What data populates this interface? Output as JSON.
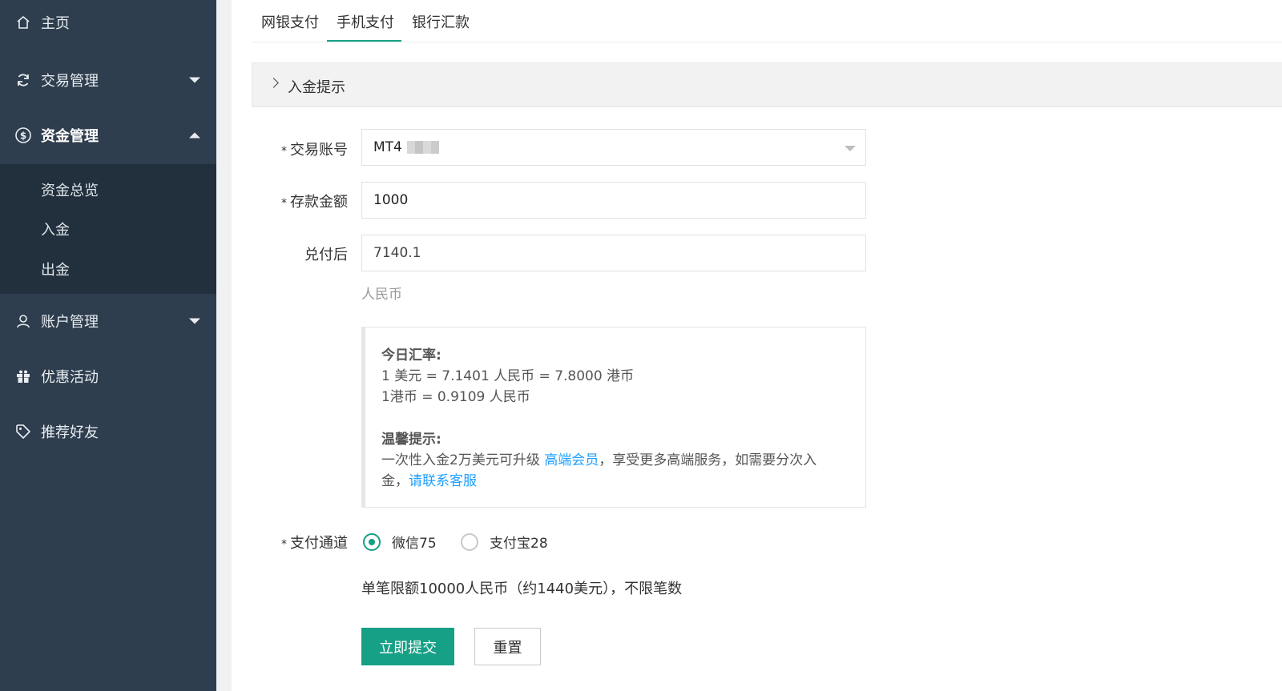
{
  "sidebar": {
    "items": [
      {
        "label": "主页",
        "icon": "home-icon"
      },
      {
        "label": "交易管理",
        "icon": "refresh-icon"
      },
      {
        "label": "资金管理",
        "icon": "dollar-icon"
      },
      {
        "label": "账户管理",
        "icon": "user-icon"
      },
      {
        "label": "优惠活动",
        "icon": "gift-icon"
      },
      {
        "label": "推荐好友",
        "icon": "tag-icon"
      }
    ],
    "submenu": [
      {
        "label": "资金总览"
      },
      {
        "label": "入金"
      },
      {
        "label": "出金"
      }
    ]
  },
  "tabs": [
    {
      "label": "网银支付"
    },
    {
      "label": "手机支付",
      "active": true
    },
    {
      "label": "银行汇款"
    }
  ],
  "collapse": {
    "title": "入金提示"
  },
  "form": {
    "account": {
      "required": "*",
      "label": "交易账号",
      "value": "MT4"
    },
    "amount": {
      "required": "*",
      "label": "存款金额",
      "value": "1000"
    },
    "converted": {
      "label": "兑付后",
      "value": "7140.1",
      "hint": "人民币"
    },
    "channel": {
      "required": "*",
      "label": "支付通道",
      "options": [
        {
          "label": "微信75",
          "selected": true
        },
        {
          "label": "支付宝28",
          "selected": false
        }
      ]
    },
    "limit_text": "单笔限额10000人民币（约1440美元），不限笔数"
  },
  "notice": {
    "rate_title": "今日汇率:",
    "rate_line1": "1 美元 = 7.1401 人民币 = 7.8000 港币",
    "rate_line2": "1港币 = 0.9109 人民币",
    "tip_title": "温馨提示:",
    "tip_line1_pre": "一次性入金2万美元可升级 ",
    "tip_line1_link": "高端会员",
    "tip_line1_post": "，享受更多高端服务，如需要分次入",
    "tip_line2_pre": "金，",
    "tip_line2_link": "请联系客服"
  },
  "buttons": {
    "submit": "立即提交",
    "reset": "重置"
  },
  "colors": {
    "sidebar": "#2f3e4e",
    "submenu": "#22303e",
    "accent": "#16a085",
    "link": "#1e9fff"
  }
}
